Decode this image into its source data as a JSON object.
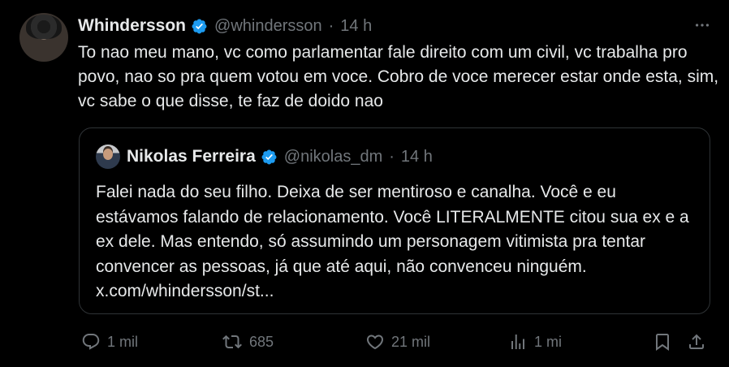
{
  "tweet": {
    "author_name": "Whindersson",
    "author_handle": "@whindersson",
    "separator": "·",
    "time": "14 h",
    "text": "To nao meu mano, vc como parlamentar fale direito com um civil, vc trabalha pro povo, nao so pra quem votou em voce. Cobro de voce merecer estar onde esta, sim, vc sabe o que disse, te faz de doido nao"
  },
  "quote": {
    "author_name": "Nikolas Ferreira",
    "author_handle": "@nikolas_dm",
    "separator": "·",
    "time": "14 h",
    "text": "Falei nada do seu filho. Deixa de ser mentiroso e canalha. Você e eu estávamos falando de relacionamento. Você LITERALMENTE citou sua ex e a ex dele. Mas entendo, só assumindo um personagem vitimista pra tentar convencer as pessoas, já que até aqui, não convenceu ninguém. x.com/whindersson/st..."
  },
  "actions": {
    "replies": "1 mil",
    "retweets": "685",
    "likes": "21 mil",
    "views": "1 mi"
  },
  "colors": {
    "background": "#000000",
    "text": "#e7e9ea",
    "muted": "#71767b",
    "verified": "#1d9bf0",
    "border": "#2f3336"
  },
  "icons": [
    "more-icon",
    "verified-badge-icon",
    "reply-icon",
    "retweet-icon",
    "like-icon",
    "views-icon",
    "bookmark-icon",
    "share-icon"
  ]
}
